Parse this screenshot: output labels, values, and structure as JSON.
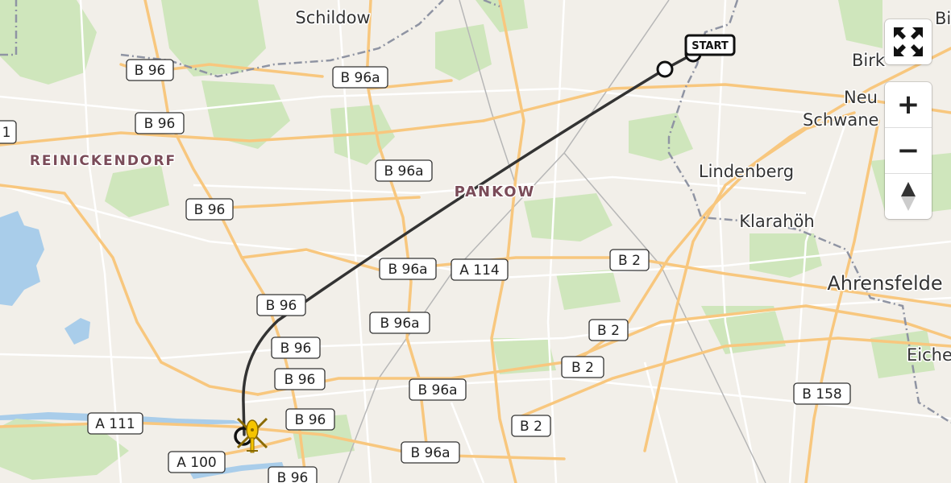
{
  "places": [
    {
      "id": "schildow",
      "text": "Schildow"
    },
    {
      "id": "reinickendorf",
      "text": "REINICKENDORF"
    },
    {
      "id": "pankow",
      "text": "PANKOW"
    },
    {
      "id": "lindenberg",
      "text": "Lindenberg"
    },
    {
      "id": "klarahoeh",
      "text": "Klarahöh"
    },
    {
      "id": "ahrensfelde",
      "text": "Ahrensfelde"
    },
    {
      "id": "neu",
      "text": "Neu"
    },
    {
      "id": "schwane",
      "text": "Schwane"
    },
    {
      "id": "birk",
      "text": "Birk"
    },
    {
      "id": "bi",
      "text": "Bi"
    },
    {
      "id": "eiche",
      "text": "Eiche"
    }
  ],
  "road_labels": [
    {
      "id": "b96-1",
      "text": "B 96"
    },
    {
      "id": "b96a-1",
      "text": "B 96a"
    },
    {
      "id": "b96-2",
      "text": "B 96"
    },
    {
      "id": "one",
      "text": "1"
    },
    {
      "id": "b96a-2",
      "text": "B 96a"
    },
    {
      "id": "b96-3",
      "text": "B 96"
    },
    {
      "id": "b96a-3",
      "text": "B 96a"
    },
    {
      "id": "a114",
      "text": "A 114"
    },
    {
      "id": "b2-1",
      "text": "B 2"
    },
    {
      "id": "b96-4",
      "text": "B 96"
    },
    {
      "id": "b96a-4",
      "text": "B 96a"
    },
    {
      "id": "b2-2",
      "text": "B 2"
    },
    {
      "id": "b96-5",
      "text": "B 96"
    },
    {
      "id": "b2-3",
      "text": "B 2"
    },
    {
      "id": "b96-6",
      "text": "B 96"
    },
    {
      "id": "b96a-5",
      "text": "B 96a"
    },
    {
      "id": "b158",
      "text": "B 158"
    },
    {
      "id": "a111",
      "text": "A 111"
    },
    {
      "id": "b96-7",
      "text": "B 96"
    },
    {
      "id": "b2-4",
      "text": "B 2"
    },
    {
      "id": "a100",
      "text": "A 100"
    },
    {
      "id": "b96a-6",
      "text": "B 96a"
    },
    {
      "id": "b96-8",
      "text": "B 96"
    }
  ],
  "start_label": "START",
  "controls": {
    "fullscreen": "fullscreen-icon",
    "zoom_in": "+",
    "zoom_out": "−",
    "compass": "compass-icon"
  },
  "colors": {
    "land": "#f2efe9",
    "forest": "#cfe6bc",
    "water": "#a9cdea",
    "major_road": "#f8c77e",
    "route": "#333333",
    "boundary": "#8f94a3"
  }
}
